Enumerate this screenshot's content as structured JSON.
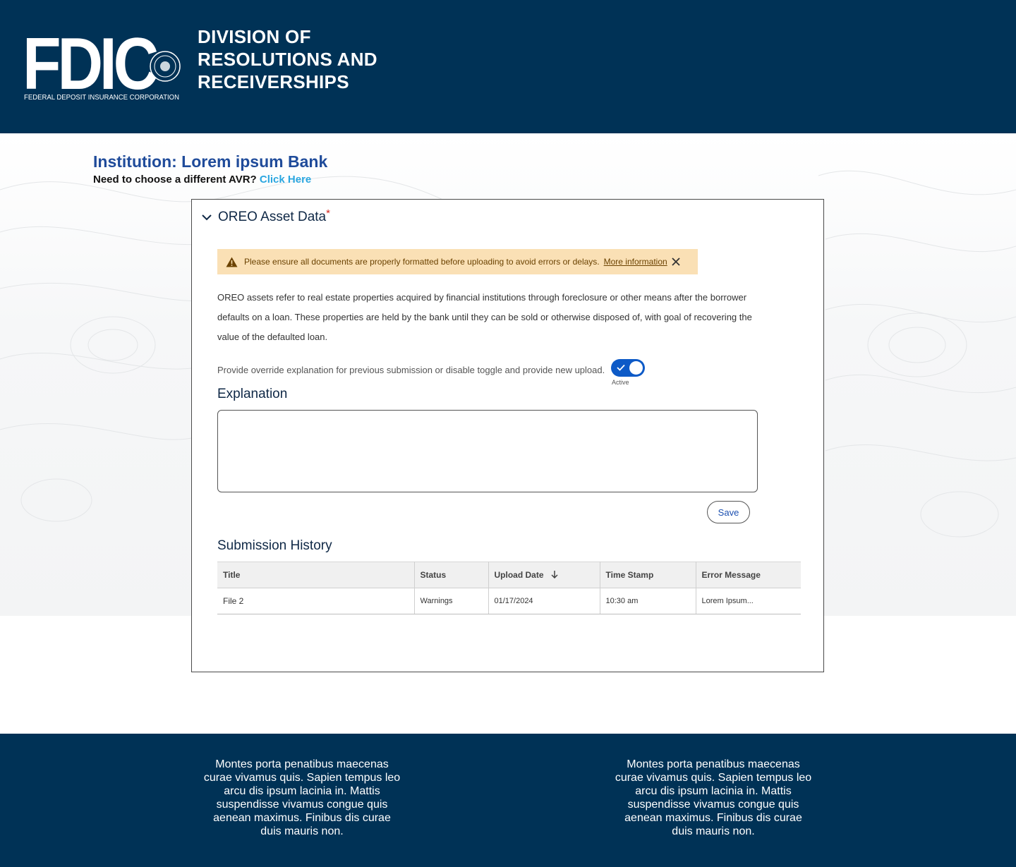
{
  "header": {
    "logo": {
      "letters": "FDIC",
      "tagline": "FEDERAL DEPOSIT INSURANCE CORPORATION",
      "icon": "fdic-seal"
    },
    "division_lines": [
      "DIVISION OF",
      "RESOLUTIONS AND",
      "RECEIVERSHIPS"
    ]
  },
  "institution": {
    "title": "Institution: Lorem ipsum Bank",
    "prompt": "Need to choose a different AVR?",
    "link": "Click Here"
  },
  "accordion": {
    "title": "OREO Asset Data",
    "required_mark": "*",
    "expanded": true,
    "alert": {
      "message": "Please ensure all documents are properly formatted before uploading to avoid errors or delays.",
      "link": "More information"
    },
    "description": "OREO assets refer to real estate properties acquired by financial institutions through foreclosure or other means after the borrower defaults on a loan. These properties are held by the bank until they can be sold or otherwise disposed of, with goal of recovering the value of the defaulted loan.",
    "toggle": {
      "label": "Provide override explanation for previous submission or disable toggle and provide new upload.",
      "state": "Active",
      "on": true
    },
    "explanation": {
      "label": "Explanation",
      "value": "",
      "placeholder": ""
    },
    "save_label": "Save",
    "history": {
      "label": "Submission History",
      "columns": [
        "Title",
        "Status",
        "Upload Date",
        "Time Stamp",
        "Error Message"
      ],
      "rows": [
        [
          "File 2",
          "Warnings",
          "01/17/2024",
          "10:30 am",
          "Lorem Ipsum..."
        ]
      ]
    }
  },
  "footer": {
    "left": "Montes porta penatibus maecenas curae vivamus quis. Sapien tempus leo arcu dis ipsum lacinia in. Mattis suspendisse vivamus congue quis aenean maximus. Finibus dis curae duis mauris non.",
    "right": "Montes porta penatibus maecenas curae vivamus quis. Sapien tempus leo arcu dis ipsum lacinia in. Mattis suspendisse vivamus congue quis aenean maximus. Finibus dis curae duis mauris non."
  },
  "colors": {
    "navy": "#003256",
    "link_blue": "#2aa6e0",
    "title_blue": "#1f4b9a",
    "alert_bg": "#fae0b5",
    "toggle_blue": "#0d5ac7",
    "required_red": "#d5271f"
  }
}
